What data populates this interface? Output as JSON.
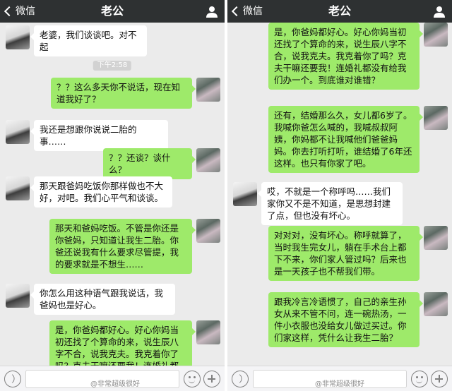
{
  "nav": {
    "back_label": "微信",
    "title": "老公"
  },
  "left": {
    "messages": [
      {
        "from": "other",
        "text": "老婆，我们谈谈吧。对不起"
      },
      {
        "timestamp": "下午2:58"
      },
      {
        "from": "me",
        "text": "？？这么多天你不说话，现在知道我好了？"
      },
      {
        "from": "other",
        "text": "我还是想跟你说说二胎的事……"
      },
      {
        "from": "me",
        "text": "？？还谈？谈什么？"
      },
      {
        "from": "other",
        "text": "那天跟爸妈吃饭你那样做也不大好，对吧。我们心平气和谈谈。"
      },
      {
        "from": "me",
        "text": "那天和爸妈吃饭。不管是你还是你爸妈，只知道让我生二胎。你爸还说我有什么要求尽管提，我的要求就是不想生……"
      },
      {
        "from": "other",
        "text": "你怎么用这种语气跟我说话，我爸妈也是好心。"
      },
      {
        "from": "me",
        "text": "是，你爸妈都好心。好心你妈当初还找了个算命的来，说生辰八字不合，说我克夫。我克着你了吗？克夫干嘛还要我！连婚礼都没有给我"
      }
    ],
    "watermark": "@非常超级很好"
  },
  "right": {
    "messages": [
      {
        "from": "me",
        "text": "是，你爸妈都好心。好心你妈当初还找了个算命的来，说生辰八字不合，说我克夫。我克着你了吗？克夫干嘛还要我！连婚礼都没有给我们办一个。到底谁对谁错？"
      },
      {
        "from": "me",
        "text": "还有，结婚那么久，女儿都6岁了。我喊你爸怎么喊的，我喊叔叔阿姨，你妈都不让我喊他们爸爸妈妈。你去打听打听，谁结婚了6年还这样。也只有你家了吧。"
      },
      {
        "from": "other",
        "text": "哎，不就是一个称呼吗……我们家你又不是不知道，是思想封建了点，但也没有坏心。"
      },
      {
        "from": "me",
        "text": "对对对，没有坏心。称呼就算了，当时我生完女儿，躺在手术台上都下不来，你们家人管过吗？后来也是一天孩子也不帮我们带。"
      },
      {
        "from": "me",
        "text": "跟我冷言冷语惯了，自己的亲生孙女从来不管不问，连一碗热汤，一件小衣服也没给女儿做过买过。你们家这样，凭什么让我生二胎？"
      }
    ],
    "watermark": "@非常超级很好"
  },
  "colors": {
    "nav_bg": "#2e3132",
    "chat_bg": "#ebebeb",
    "bubble_out": "#9eea6a",
    "bubble_in": "#ffffff"
  },
  "icons": {
    "back": "chevron-left-icon",
    "profile": "person-icon",
    "voice": "voice-icon",
    "emoji": "emoji-icon",
    "more": "plus-icon"
  }
}
